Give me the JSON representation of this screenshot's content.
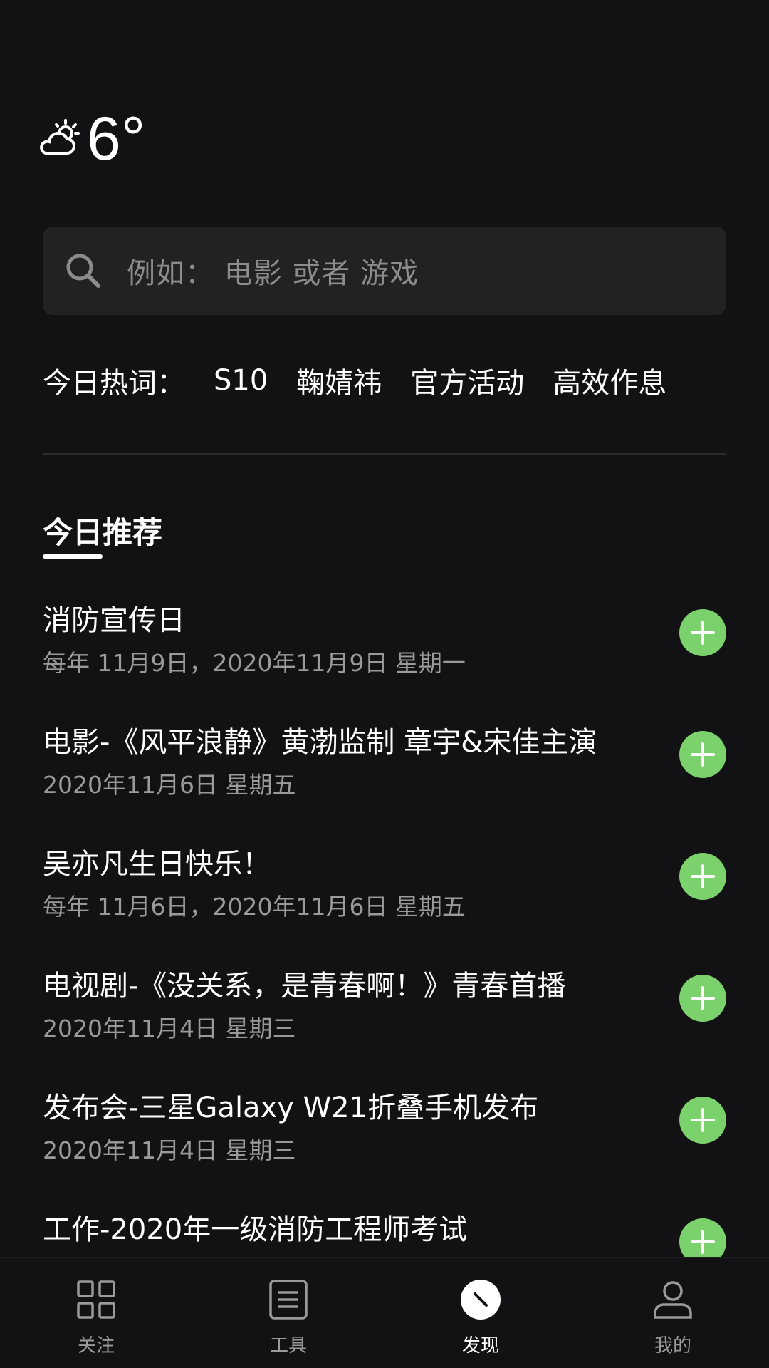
{
  "weather": {
    "temperature": "6°",
    "icon": "partly-cloudy-icon"
  },
  "search": {
    "placeholder": "例如：  电影 或者 游戏"
  },
  "hot_words": {
    "label": "今日热词：",
    "items": [
      "S10",
      "鞠婧祎",
      "官方活动",
      "高效作息"
    ]
  },
  "section": {
    "title": "今日推荐"
  },
  "recommendations": [
    {
      "title": "消防宣传日",
      "date": "每年 11月9日，2020年11月9日 星期一"
    },
    {
      "title": "电影-《风平浪静》黄渤监制 章宇&宋佳主演",
      "date": "2020年11月6日 星期五"
    },
    {
      "title": "吴亦凡生日快乐！",
      "date": "每年 11月6日，2020年11月6日 星期五"
    },
    {
      "title": "电视剧-《没关系，是青春啊！》青春首播",
      "date": "2020年11月4日 星期三"
    },
    {
      "title": "发布会-三星Galaxy W21折叠手机发布",
      "date": "2020年11月4日 星期三"
    },
    {
      "title": "工作-2020年一级消防工程师考试",
      "date": ""
    }
  ],
  "bottom_nav": {
    "items": [
      {
        "label": "关注",
        "icon": "grid-icon",
        "active": false
      },
      {
        "label": "工具",
        "icon": "document-icon",
        "active": false
      },
      {
        "label": "发现",
        "icon": "compass-icon",
        "active": true
      },
      {
        "label": "我的",
        "icon": "profile-icon",
        "active": false
      }
    ]
  },
  "colors": {
    "background": "#121214",
    "search_bg": "#222224",
    "accent_green": "#7bd16b",
    "secondary_text": "#9a9a9a"
  }
}
